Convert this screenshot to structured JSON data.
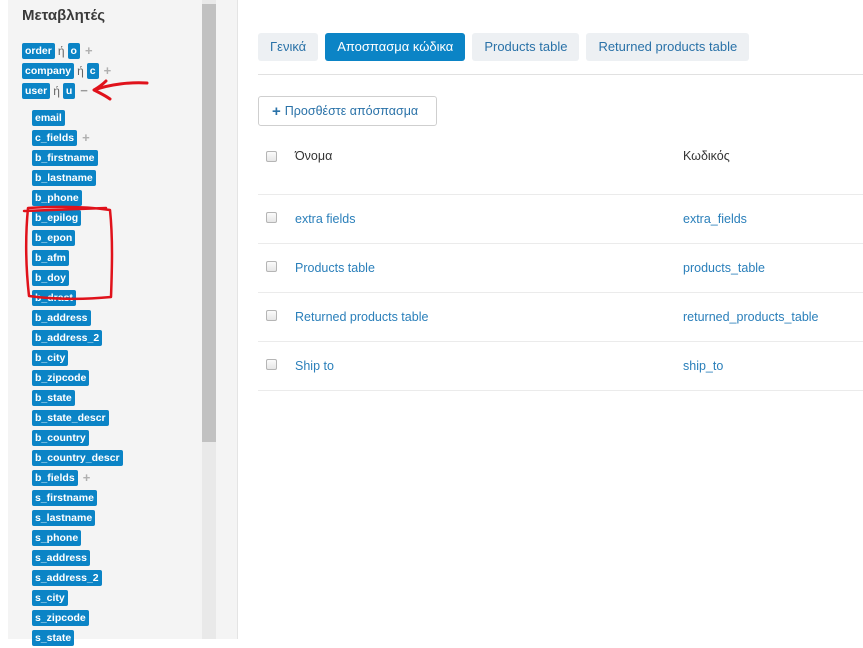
{
  "sidebar": {
    "title": "Μεταβλητές",
    "top_vars": [
      {
        "name": "order",
        "or": "ή",
        "alias": "o",
        "toggle": "+"
      },
      {
        "name": "company",
        "or": "ή",
        "alias": "c",
        "toggle": "+"
      },
      {
        "name": "user",
        "or": "ή",
        "alias": "u",
        "toggle": "−"
      }
    ],
    "user_fields": [
      {
        "label": "email"
      },
      {
        "label": "c_fields",
        "toggle": "+"
      },
      {
        "label": "b_firstname"
      },
      {
        "label": "b_lastname"
      },
      {
        "label": "b_phone"
      },
      {
        "label": "b_epilog"
      },
      {
        "label": "b_epon"
      },
      {
        "label": "b_afm"
      },
      {
        "label": "b_doy"
      },
      {
        "label": "b_drast"
      },
      {
        "label": "b_address"
      },
      {
        "label": "b_address_2"
      },
      {
        "label": "b_city"
      },
      {
        "label": "b_zipcode"
      },
      {
        "label": "b_state"
      },
      {
        "label": "b_state_descr"
      },
      {
        "label": "b_country"
      },
      {
        "label": "b_country_descr"
      },
      {
        "label": "b_fields",
        "toggle": "+"
      },
      {
        "label": "s_firstname"
      },
      {
        "label": "s_lastname"
      },
      {
        "label": "s_phone"
      },
      {
        "label": "s_address"
      },
      {
        "label": "s_address_2"
      },
      {
        "label": "s_city"
      },
      {
        "label": "s_zipcode"
      },
      {
        "label": "s_state"
      }
    ]
  },
  "tabs": [
    {
      "label": "Γενικά",
      "active": false
    },
    {
      "label": "Αποσπασμα κώδικα",
      "active": true
    },
    {
      "label": "Products table",
      "active": false
    },
    {
      "label": "Returned products table",
      "active": false
    }
  ],
  "add_button": {
    "icon": "plus-icon",
    "label": "Προσθέστε απόσπασμα"
  },
  "table": {
    "headers": {
      "name": "Όνομα",
      "code": "Κωδικός"
    },
    "rows": [
      {
        "name": "extra fields",
        "code": "extra_fields"
      },
      {
        "name": "Products table",
        "code": "products_table"
      },
      {
        "name": "Returned products table",
        "code": "returned_products_table"
      },
      {
        "name": "Ship to",
        "code": "ship_to"
      }
    ]
  },
  "colors": {
    "accent": "#0b84c6",
    "link": "#2a7fba",
    "annotation": "#e0121b"
  }
}
